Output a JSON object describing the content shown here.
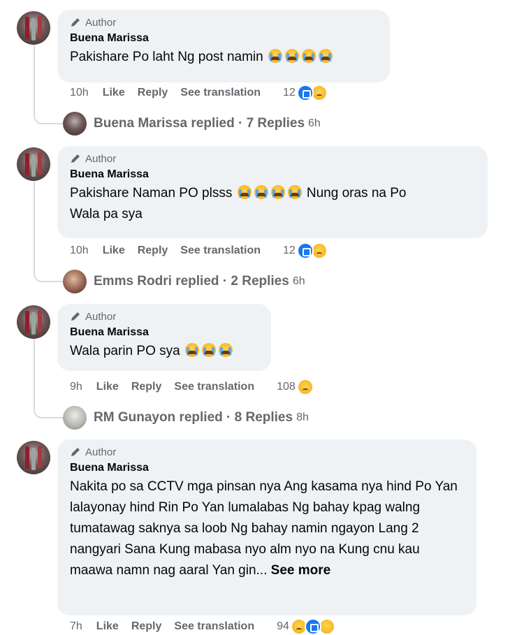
{
  "comments": [
    {
      "badge": "Author",
      "name": "Buena Marissa",
      "text": "Pakishare Po laht Ng post namin",
      "time": "10h",
      "like": "Like",
      "reply": "Reply",
      "translate": "See translation",
      "reaction_count": "12",
      "replies_text": "Buena Marissa replied · 7 Replies",
      "replies_time": "6h"
    },
    {
      "badge": "Author",
      "name": "Buena Marissa",
      "text_line1": "Pakishare Naman PO plsss",
      "text_line1b": "Nung oras na Po",
      "text_line2": "Wala pa sya",
      "time": "10h",
      "like": "Like",
      "reply": "Reply",
      "translate": "See translation",
      "reaction_count": "12",
      "replies_text": "Emms Rodri replied · 2 Replies",
      "replies_time": "6h"
    },
    {
      "badge": "Author",
      "name": "Buena Marissa",
      "text": "Wala parin PO sya",
      "time": "9h",
      "like": "Like",
      "reply": "Reply",
      "translate": "See translation",
      "reaction_count": "108",
      "replies_text": "RM Gunayon replied · 8 Replies",
      "replies_time": "8h"
    },
    {
      "badge": "Author",
      "name": "Buena Marissa",
      "text": "Nakita po sa CCTV mga pinsan nya Ang kasama nya hind Po Yan lalayonay hind Rin Po Yan lumalabas Ng bahay kpag walng tumatawag saknya sa loob Ng bahay namin ngayon Lang 2 nangyari Sana Kung mabasa nyo alm nyo na Kung cnu kau maawa namn nag aaral Yan gin...",
      "see_more": "See more",
      "time": "7h",
      "like": "Like",
      "reply": "Reply",
      "translate": "See translation",
      "reaction_count": "94"
    }
  ],
  "icons": {
    "badge_icon": "pencil-icon",
    "reaction_like": "like-reaction-icon",
    "reaction_sad": "sad-reaction-icon",
    "emoji": "crying-emoji-icon"
  },
  "colors": {
    "bubble": "#eff2f5",
    "secondary_text": "#65676b",
    "like_blue": "#1877f2"
  }
}
